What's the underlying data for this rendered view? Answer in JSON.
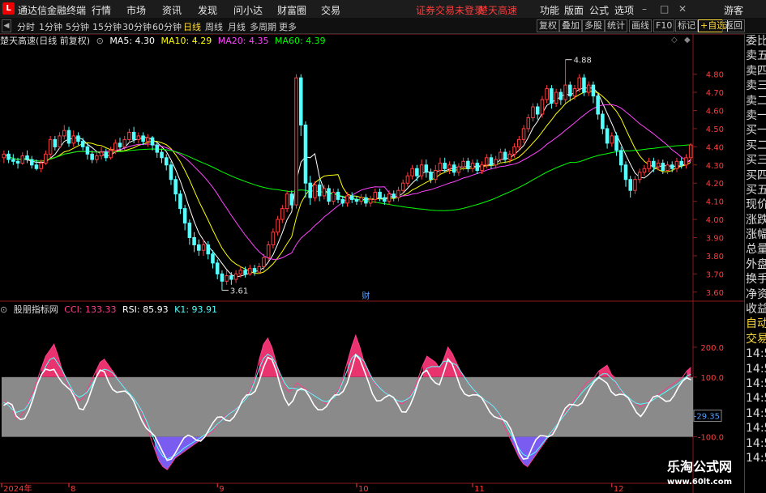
{
  "menubar": {
    "logo": "L",
    "app_title": "通达信金融终端",
    "items": [
      "行情",
      "市场",
      "资讯",
      "发现",
      "问小达",
      "财富圈",
      "交易"
    ],
    "alert": "证券交易未登录",
    "stock_name": "楚天高速",
    "right_items": [
      "功能",
      "版面",
      "公式",
      "选项"
    ],
    "window_icons": [
      "minimize-icon",
      "maximize-icon",
      "close-icon"
    ],
    "user": "游客"
  },
  "tabbar": {
    "left_arrow": "◀",
    "periods": [
      "分时",
      "1分钟",
      "5分钟",
      "15分钟",
      "30分钟",
      "60分钟",
      "日线",
      "周线",
      "月线",
      "多周期",
      "更多"
    ],
    "active_period": "日线",
    "right_buttons": [
      "复权",
      "叠加",
      "多股",
      "统计",
      "画线",
      "F10",
      "标记",
      "+自选",
      "返回"
    ]
  },
  "main_info": {
    "name": "楚天高速(日线 前复权)",
    "ma5": "MA5: 4.30",
    "ma10": "MA10: 4.29",
    "ma20": "MA20: 4.35",
    "ma60": "MA60: 4.39",
    "high_label": "4.88",
    "low_label": "3.61",
    "marker": "财",
    "colors": {
      "ma5": "#ffffff",
      "ma10": "#ffff00",
      "ma20": "#ff44ff",
      "ma60": "#00ff00",
      "up": "#ff3c3c",
      "down": "#54ffff"
    }
  },
  "ind_info": {
    "name": "股朋指标网",
    "cci": "CCI: 133.33",
    "rsi": "RSI: 85.93",
    "k1": "K1: 93.91",
    "current_label": "-29.35"
  },
  "side_panel": {
    "items": [
      "委比",
      "卖五",
      "卖四",
      "卖三",
      "卖二",
      "卖一",
      "买一",
      "买二",
      "买三",
      "买四",
      "买五",
      "现价",
      "涨跌",
      "涨幅",
      "总量",
      "外盘",
      "换手",
      "净资",
      "收益",
      "自动",
      "交易",
      "14:56",
      "14:56",
      "14:56",
      "14:56",
      "14:56",
      "14:56",
      "14:56",
      "14:56"
    ]
  },
  "watermark": {
    "line1": "乐淘公式网",
    "line2": "www.60lt.com"
  },
  "chart_data": [
    {
      "type": "candlestick",
      "title": "楚天高速(日线 前复权)",
      "ylim": [
        3.55,
        4.95
      ],
      "y_ticks": [
        3.6,
        3.7,
        3.8,
        3.9,
        4.0,
        4.1,
        4.2,
        4.3,
        4.4,
        4.5,
        4.6,
        4.7,
        4.8
      ],
      "x_ticks": [
        "2024年",
        "8",
        "9",
        "10",
        "11",
        "12",
        "1"
      ],
      "x_tick_index": [
        0,
        14,
        46,
        76,
        101,
        131,
        163
      ],
      "high": 4.88,
      "low": 3.61,
      "candles": [
        [
          4.34,
          4.36,
          4.38,
          4.31
        ],
        [
          4.36,
          4.33,
          4.38,
          4.31
        ],
        [
          4.33,
          4.32,
          4.36,
          4.3
        ],
        [
          4.32,
          4.31,
          4.34,
          4.28
        ],
        [
          4.31,
          4.35,
          4.37,
          4.3
        ],
        [
          4.35,
          4.33,
          4.38,
          4.31
        ],
        [
          4.33,
          4.3,
          4.35,
          4.28
        ],
        [
          4.3,
          4.28,
          4.33,
          4.27
        ],
        [
          4.28,
          4.31,
          4.33,
          4.26
        ],
        [
          4.31,
          4.36,
          4.38,
          4.3
        ],
        [
          4.36,
          4.44,
          4.46,
          4.34
        ],
        [
          4.44,
          4.4,
          4.46,
          4.38
        ],
        [
          4.4,
          4.46,
          4.48,
          4.39
        ],
        [
          4.46,
          4.49,
          4.52,
          4.44
        ],
        [
          4.49,
          4.42,
          4.51,
          4.4
        ],
        [
          4.42,
          4.46,
          4.49,
          4.4
        ],
        [
          4.46,
          4.43,
          4.48,
          4.41
        ],
        [
          4.43,
          4.4,
          4.45,
          4.38
        ],
        [
          4.4,
          4.36,
          4.42,
          4.33
        ],
        [
          4.36,
          4.33,
          4.38,
          4.31
        ],
        [
          4.33,
          4.35,
          4.37,
          4.31
        ],
        [
          4.35,
          4.37,
          4.4,
          4.33
        ],
        [
          4.37,
          4.34,
          4.39,
          4.32
        ],
        [
          4.34,
          4.38,
          4.4,
          4.33
        ],
        [
          4.38,
          4.42,
          4.44,
          4.36
        ],
        [
          4.42,
          4.4,
          4.45,
          4.38
        ],
        [
          4.4,
          4.44,
          4.46,
          4.38
        ],
        [
          4.44,
          4.48,
          4.5,
          4.42
        ],
        [
          4.48,
          4.44,
          4.51,
          4.42
        ],
        [
          4.44,
          4.46,
          4.48,
          4.42
        ],
        [
          4.46,
          4.43,
          4.48,
          4.41
        ],
        [
          4.43,
          4.45,
          4.47,
          4.4
        ],
        [
          4.45,
          4.41,
          4.46,
          4.38
        ],
        [
          4.41,
          4.37,
          4.43,
          4.34
        ],
        [
          4.37,
          4.34,
          4.39,
          4.31
        ],
        [
          4.34,
          4.3,
          4.36,
          4.27
        ],
        [
          4.3,
          4.22,
          4.32,
          4.19
        ],
        [
          4.22,
          4.14,
          4.24,
          4.1
        ],
        [
          4.14,
          4.06,
          4.16,
          4.03
        ],
        [
          4.06,
          3.98,
          4.08,
          3.94
        ],
        [
          3.98,
          3.9,
          4.0,
          3.86
        ],
        [
          3.9,
          3.86,
          3.93,
          3.82
        ],
        [
          3.86,
          3.83,
          3.89,
          3.8
        ],
        [
          3.83,
          3.86,
          3.89,
          3.8
        ],
        [
          3.86,
          3.81,
          3.88,
          3.78
        ],
        [
          3.81,
          3.76,
          3.83,
          3.73
        ],
        [
          3.76,
          3.7,
          3.78,
          3.67
        ],
        [
          3.7,
          3.66,
          3.72,
          3.61
        ],
        [
          3.66,
          3.69,
          3.72,
          3.64
        ],
        [
          3.69,
          3.67,
          3.71,
          3.64
        ],
        [
          3.67,
          3.7,
          3.72,
          3.65
        ],
        [
          3.7,
          3.72,
          3.74,
          3.68
        ],
        [
          3.72,
          3.7,
          3.74,
          3.68
        ],
        [
          3.7,
          3.73,
          3.75,
          3.69
        ],
        [
          3.73,
          3.71,
          3.75,
          3.69
        ],
        [
          3.71,
          3.74,
          3.76,
          3.7
        ],
        [
          3.74,
          3.79,
          3.81,
          3.72
        ],
        [
          3.79,
          3.86,
          3.88,
          3.77
        ],
        [
          3.86,
          3.93,
          3.95,
          3.84
        ],
        [
          3.93,
          4.0,
          4.02,
          3.91
        ],
        [
          4.0,
          4.06,
          4.08,
          3.98
        ],
        [
          4.06,
          4.14,
          4.16,
          4.04
        ],
        [
          4.14,
          4.08,
          4.16,
          4.06
        ],
        [
          4.08,
          4.78,
          4.8,
          4.06
        ],
        [
          4.78,
          4.52,
          4.8,
          4.46
        ],
        [
          4.52,
          4.2,
          4.54,
          4.12
        ],
        [
          4.2,
          4.12,
          4.24,
          4.08
        ],
        [
          4.12,
          4.19,
          4.21,
          4.1
        ],
        [
          4.19,
          4.13,
          4.22,
          4.1
        ],
        [
          4.13,
          4.17,
          4.19,
          4.11
        ],
        [
          4.17,
          4.1,
          4.19,
          4.08
        ],
        [
          4.1,
          4.15,
          4.17,
          4.08
        ],
        [
          4.15,
          4.11,
          4.17,
          4.09
        ],
        [
          4.11,
          4.09,
          4.13,
          4.07
        ],
        [
          4.09,
          4.13,
          4.15,
          4.07
        ],
        [
          4.13,
          4.11,
          4.15,
          4.09
        ],
        [
          4.11,
          4.1,
          4.13,
          4.08
        ],
        [
          4.1,
          4.12,
          4.14,
          4.08
        ],
        [
          4.12,
          4.09,
          4.14,
          4.07
        ],
        [
          4.09,
          4.11,
          4.13,
          4.07
        ],
        [
          4.11,
          4.15,
          4.17,
          4.09
        ],
        [
          4.15,
          4.12,
          4.17,
          4.1
        ],
        [
          4.12,
          4.1,
          4.14,
          4.08
        ],
        [
          4.1,
          4.14,
          4.16,
          4.08
        ],
        [
          4.14,
          4.12,
          4.16,
          4.1
        ],
        [
          4.12,
          4.16,
          4.18,
          4.1
        ],
        [
          4.16,
          4.2,
          4.22,
          4.14
        ],
        [
          4.2,
          4.24,
          4.26,
          4.18
        ],
        [
          4.24,
          4.28,
          4.3,
          4.22
        ],
        [
          4.28,
          4.24,
          4.3,
          4.21
        ],
        [
          4.24,
          4.3,
          4.33,
          4.22
        ],
        [
          4.3,
          4.26,
          4.33,
          4.23
        ],
        [
          4.26,
          4.22,
          4.28,
          4.2
        ],
        [
          4.22,
          4.27,
          4.3,
          4.2
        ],
        [
          4.27,
          4.31,
          4.34,
          4.25
        ],
        [
          4.31,
          4.28,
          4.34,
          4.26
        ],
        [
          4.28,
          4.3,
          4.32,
          4.25
        ],
        [
          4.3,
          4.26,
          4.32,
          4.24
        ],
        [
          4.26,
          4.29,
          4.31,
          4.24
        ],
        [
          4.29,
          4.32,
          4.34,
          4.27
        ],
        [
          4.32,
          4.28,
          4.34,
          4.26
        ],
        [
          4.28,
          4.31,
          4.33,
          4.26
        ],
        [
          4.31,
          4.27,
          4.33,
          4.25
        ],
        [
          4.27,
          4.3,
          4.32,
          4.25
        ],
        [
          4.3,
          4.34,
          4.36,
          4.28
        ],
        [
          4.34,
          4.3,
          4.36,
          4.28
        ],
        [
          4.3,
          4.33,
          4.35,
          4.28
        ],
        [
          4.33,
          4.37,
          4.39,
          4.31
        ],
        [
          4.37,
          4.33,
          4.39,
          4.31
        ],
        [
          4.33,
          4.36,
          4.38,
          4.31
        ],
        [
          4.36,
          4.4,
          4.42,
          4.34
        ],
        [
          4.4,
          4.44,
          4.46,
          4.38
        ],
        [
          4.44,
          4.5,
          4.52,
          4.42
        ],
        [
          4.5,
          4.56,
          4.58,
          4.48
        ],
        [
          4.56,
          4.62,
          4.64,
          4.54
        ],
        [
          4.62,
          4.58,
          4.64,
          4.55
        ],
        [
          4.58,
          4.66,
          4.68,
          4.56
        ],
        [
          4.66,
          4.72,
          4.74,
          4.64
        ],
        [
          4.72,
          4.64,
          4.74,
          4.61
        ],
        [
          4.64,
          4.7,
          4.72,
          4.62
        ],
        [
          4.7,
          4.66,
          4.72,
          4.63
        ],
        [
          4.66,
          4.74,
          4.88,
          4.64
        ],
        [
          4.74,
          4.68,
          4.76,
          4.65
        ],
        [
          4.68,
          4.72,
          4.74,
          4.66
        ],
        [
          4.72,
          4.78,
          4.8,
          4.7
        ],
        [
          4.78,
          4.7,
          4.8,
          4.68
        ],
        [
          4.7,
          4.74,
          4.76,
          4.68
        ],
        [
          4.74,
          4.68,
          4.76,
          4.64
        ],
        [
          4.68,
          4.58,
          4.7,
          4.55
        ],
        [
          4.58,
          4.5,
          4.6,
          4.47
        ],
        [
          4.5,
          4.42,
          4.52,
          4.39
        ],
        [
          4.42,
          4.46,
          4.48,
          4.4
        ],
        [
          4.46,
          4.38,
          4.48,
          4.35
        ],
        [
          4.38,
          4.3,
          4.4,
          4.26
        ],
        [
          4.3,
          4.22,
          4.32,
          4.18
        ],
        [
          4.22,
          4.16,
          4.24,
          4.12
        ],
        [
          4.16,
          4.22,
          4.24,
          4.14
        ],
        [
          4.22,
          4.26,
          4.28,
          4.2
        ],
        [
          4.26,
          4.28,
          4.3,
          4.24
        ],
        [
          4.28,
          4.32,
          4.34,
          4.26
        ],
        [
          4.32,
          4.29,
          4.34,
          4.26
        ],
        [
          4.29,
          4.31,
          4.33,
          4.27
        ],
        [
          4.31,
          4.27,
          4.33,
          4.25
        ],
        [
          4.27,
          4.3,
          4.32,
          4.25
        ],
        [
          4.3,
          4.28,
          4.32,
          4.26
        ],
        [
          4.28,
          4.32,
          4.34,
          4.26
        ],
        [
          4.32,
          4.3,
          4.34,
          4.28
        ],
        [
          4.3,
          4.34,
          4.36,
          4.28
        ],
        [
          4.34,
          4.41,
          4.42,
          4.32
        ]
      ],
      "series": [
        {
          "name": "MA5",
          "color": "#ffffff"
        },
        {
          "name": "MA10",
          "color": "#ffff00"
        },
        {
          "name": "MA20",
          "color": "#ff44ff"
        },
        {
          "name": "MA60",
          "color": "#00ff00"
        }
      ],
      "grid": false
    },
    {
      "type": "line",
      "title": "股朋指标网",
      "ylim": [
        -250,
        300
      ],
      "y_ticks": [
        200.0,
        100.0,
        -100.0
      ],
      "band": [
        -100,
        100
      ],
      "series": [
        {
          "name": "CCI",
          "color": "#ff3c8c",
          "values": [
            20,
            10,
            -5,
            -40,
            -30,
            -10,
            20,
            50,
            90,
            130,
            170,
            190,
            210,
            170,
            120,
            80,
            60,
            40,
            20,
            30,
            60,
            90,
            120,
            150,
            160,
            140,
            120,
            100,
            80,
            60,
            40,
            30,
            10,
            -20,
            -60,
            -100,
            -140,
            -180,
            -200,
            -210,
            -190,
            -170,
            -160,
            -150,
            -140,
            -130,
            -120,
            -110,
            -100,
            -90,
            -80,
            -60,
            -40,
            -30,
            -20,
            -10,
            0,
            20,
            40,
            60,
            100,
            160,
            210,
            230,
            200,
            150,
            100,
            70,
            50,
            60,
            80,
            70,
            60,
            50,
            40,
            30,
            20,
            10,
            20,
            40,
            60,
            100,
            150,
            200,
            240,
            200,
            150,
            120,
            90,
            70,
            60,
            50,
            40,
            30,
            20,
            10,
            20,
            40,
            60,
            100,
            140,
            170,
            160,
            150,
            130,
            160,
            200,
            180,
            150,
            120,
            100,
            80,
            60,
            40,
            30,
            20,
            10,
            0,
            -20,
            -50,
            -80,
            -110,
            -140,
            -170,
            -190,
            -200,
            -180,
            -160,
            -140,
            -120,
            -100,
            -80,
            -60,
            -40,
            -20,
            0,
            20,
            40,
            60,
            80,
            90,
            100,
            120,
            130,
            140,
            110,
            80,
            60,
            40,
            30,
            20,
            10,
            0,
            10,
            20,
            30,
            40,
            50,
            60,
            70,
            80,
            90,
            100,
            120,
            133
          ]
        },
        {
          "name": "RSI",
          "color": "#54ffff"
        },
        {
          "name": "K1",
          "color": "#ffffff"
        }
      ]
    }
  ]
}
